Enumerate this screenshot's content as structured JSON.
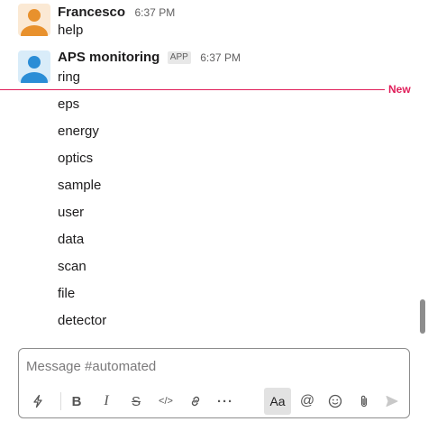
{
  "messages": [
    {
      "sender": "Francesco",
      "time": "6:37 PM",
      "text": "help",
      "avatar_color": "#e8912d"
    },
    {
      "sender": "APS monitoring",
      "badge": "APP",
      "time": "6:37 PM",
      "text": "ring",
      "avatar_color": "#2b8dd6"
    }
  ],
  "new_divider": {
    "label": "New",
    "color": "#e01e5a"
  },
  "continued_lines": [
    "eps",
    "energy",
    "optics",
    "sample",
    "user",
    "data",
    "scan",
    "file",
    "detector"
  ],
  "composer": {
    "placeholder": "Message #automated",
    "toolbar": [
      {
        "name": "shortcuts-icon",
        "glyph": "ϟ"
      },
      {
        "name": "bold-icon",
        "glyph": "B"
      },
      {
        "name": "italic-icon",
        "glyph": "I"
      },
      {
        "name": "strikethrough-icon",
        "glyph": "S"
      },
      {
        "name": "code-icon",
        "glyph": "</>"
      },
      {
        "name": "link-icon",
        "glyph": "⛓"
      },
      {
        "name": "more-icon",
        "glyph": "···"
      },
      {
        "name": "formatting-toggle-icon",
        "glyph": "Aa"
      },
      {
        "name": "mention-icon",
        "glyph": "@"
      },
      {
        "name": "emoji-icon",
        "glyph": "☺"
      },
      {
        "name": "attach-icon",
        "glyph": "📎"
      },
      {
        "name": "send-icon",
        "glyph": "➤"
      }
    ]
  }
}
